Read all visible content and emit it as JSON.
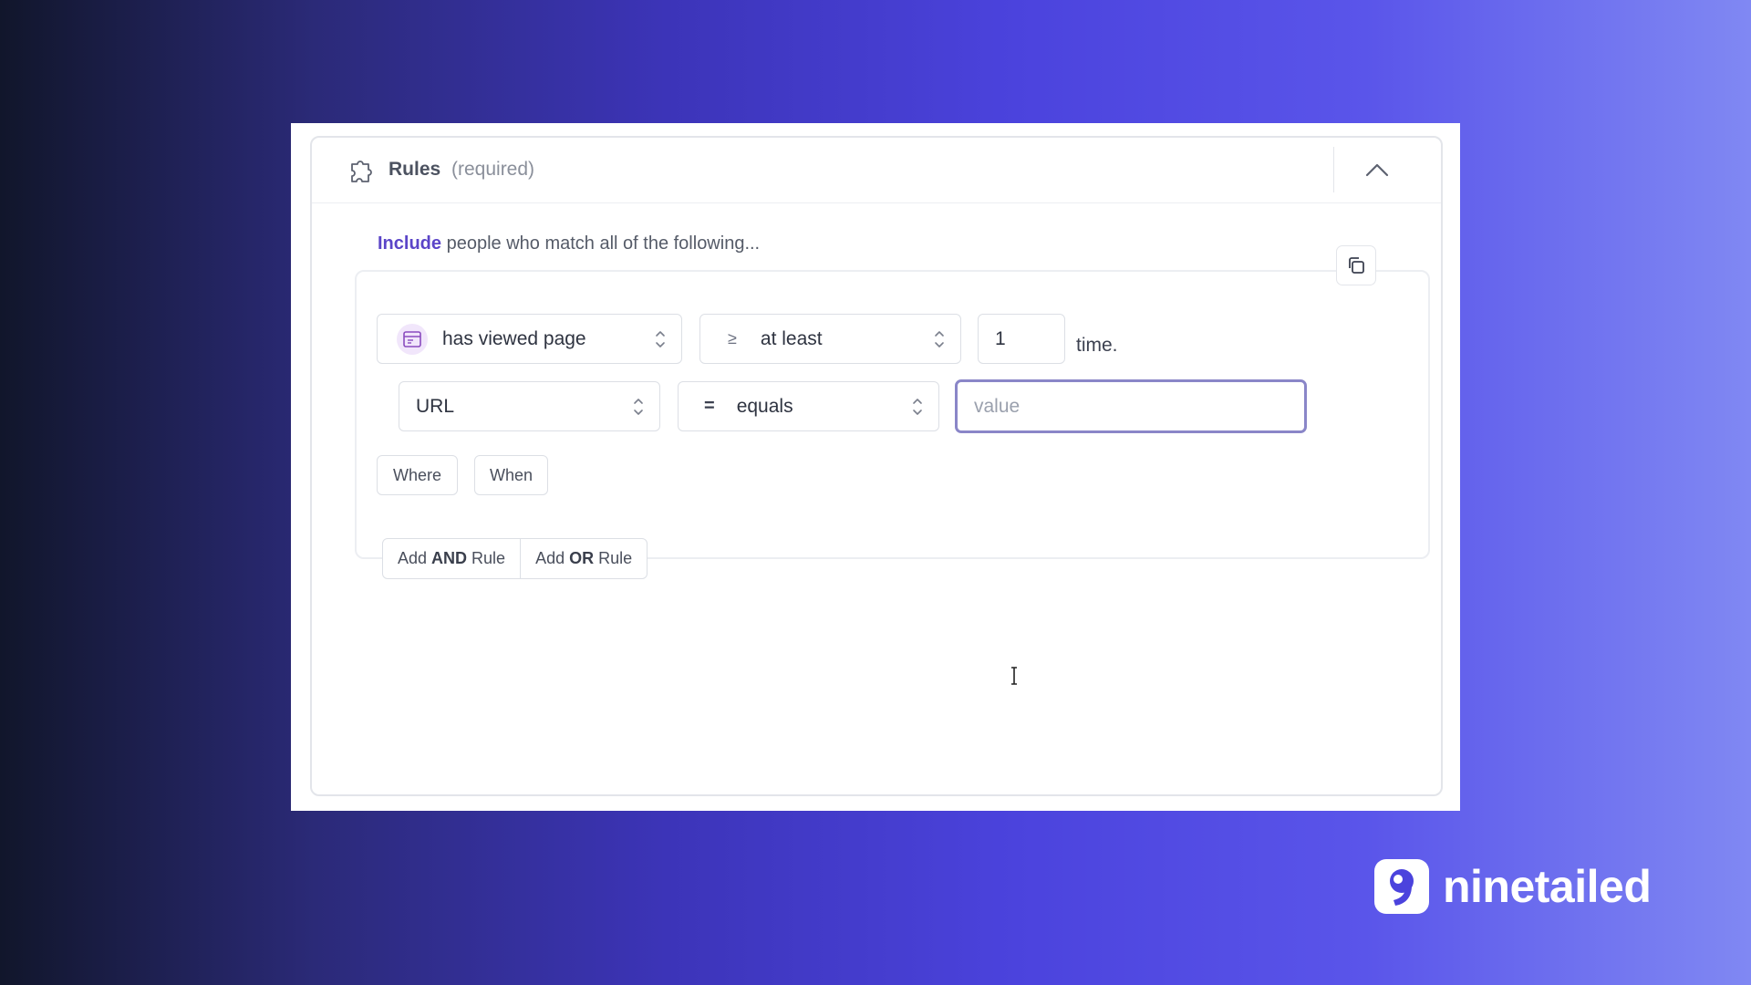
{
  "rules_panel": {
    "title": "Rules",
    "required_label": "(required)",
    "include_keyword": "Include",
    "include_text": "people who match all of the following..."
  },
  "condition": {
    "event_select": "has viewed page",
    "operator_symbol": "≥",
    "operator_select": "at least",
    "count_value": "1",
    "count_suffix": "time."
  },
  "filter": {
    "property_select": "URL",
    "comparator_symbol": "=",
    "comparator_select": "equals",
    "value_placeholder": "value"
  },
  "modifiers": {
    "where_label": "Where",
    "when_label": "When"
  },
  "add_rule": {
    "and_prefix": "Add",
    "and_keyword": "AND",
    "and_suffix": "Rule",
    "or_prefix": "Add",
    "or_keyword": "OR",
    "or_suffix": "Rule"
  },
  "brand": {
    "name": "ninetailed",
    "icon": "ninetailed-logo-icon"
  },
  "colors": {
    "accent": "#5b45c8",
    "focus_border": "#8a86c8",
    "event_icon_bg": "#f1e6fb"
  }
}
